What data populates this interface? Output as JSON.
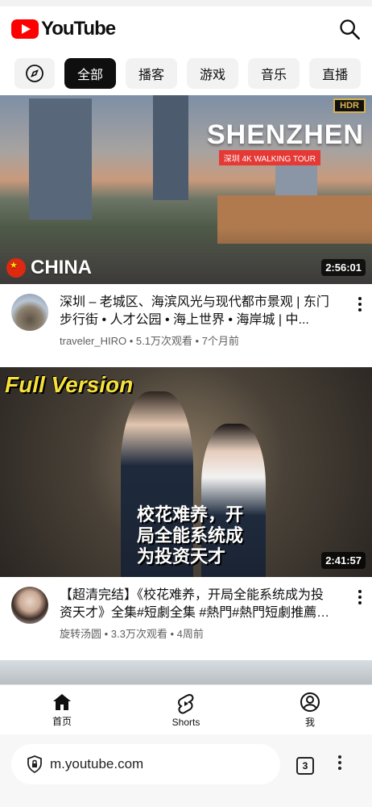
{
  "app": {
    "logo_text": "YouTube"
  },
  "chips": [
    {
      "label": "全部",
      "active": true
    },
    {
      "label": "播客"
    },
    {
      "label": "游戏"
    },
    {
      "label": "音乐"
    },
    {
      "label": "直播"
    }
  ],
  "videos": [
    {
      "title": "深圳 – 老城区、海滨风光与现代都市景观 | 东门步行街 • 人才公园 • 海上世界 • 海岸城 | 中...",
      "channel_line": "traveler_HIRO • 5.1万次观看 • 7个月前",
      "duration": "2:56:01",
      "thumb_hdr": "HDR",
      "thumb_title": "SHENZHEN",
      "thumb_sub": "深圳 4K WALKING TOUR",
      "thumb_country": "CHINA"
    },
    {
      "title": "【超清完结】《校花难养，开局全能系统成为投资天才》全集#短劇全集 #熱門#熱門短劇推薦 #...",
      "channel_line": "旋转汤圆 • 3.3万次观看 • 4周前",
      "duration": "2:41:57",
      "thumb_badge": "Full Version",
      "thumb_title": "校花难养，开局全能系统成为投资天才"
    }
  ],
  "bottom_nav": [
    {
      "label": "首页",
      "icon": "home-icon"
    },
    {
      "label": "Shorts",
      "icon": "shorts-icon"
    },
    {
      "label": "我",
      "icon": "profile-icon"
    }
  ],
  "browser": {
    "url": "m.youtube.com",
    "tab_count": "3"
  }
}
